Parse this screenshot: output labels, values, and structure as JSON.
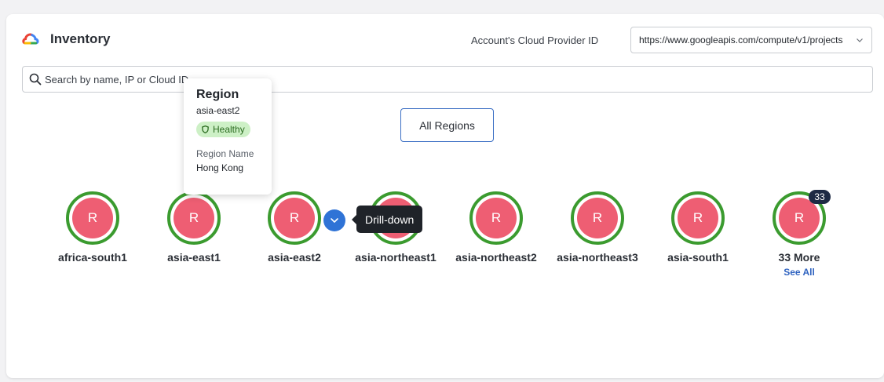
{
  "header": {
    "title": "Inventory",
    "provider_label": "Account's Cloud Provider ID",
    "provider_value": "https://www.googleapis.com/compute/v1/projects"
  },
  "search": {
    "placeholder": "Search by name, IP or Cloud ID"
  },
  "filter": {
    "all_regions_label": "All Regions"
  },
  "regions": [
    {
      "initial": "R",
      "name": "africa-south1"
    },
    {
      "initial": "R",
      "name": "asia-east1"
    },
    {
      "initial": "R",
      "name": "asia-east2"
    },
    {
      "initial": "R",
      "name": "asia-northeast1"
    },
    {
      "initial": "R",
      "name": "asia-northeast2"
    },
    {
      "initial": "R",
      "name": "asia-northeast3"
    },
    {
      "initial": "R",
      "name": "asia-south1"
    },
    {
      "initial": "R",
      "name": "33 More",
      "badge": "33",
      "link": "See All"
    }
  ],
  "tooltip": {
    "label": "Drill-down"
  },
  "popover": {
    "title": "Region",
    "region_id": "asia-east2",
    "status": "Healthy",
    "name_label": "Region Name",
    "name_value": "Hong Kong"
  },
  "colors": {
    "ring": "#3b9b2f",
    "node_fill": "#ee5e73",
    "accent": "#2f73d6",
    "healthy_bg": "#cdf0c6"
  }
}
